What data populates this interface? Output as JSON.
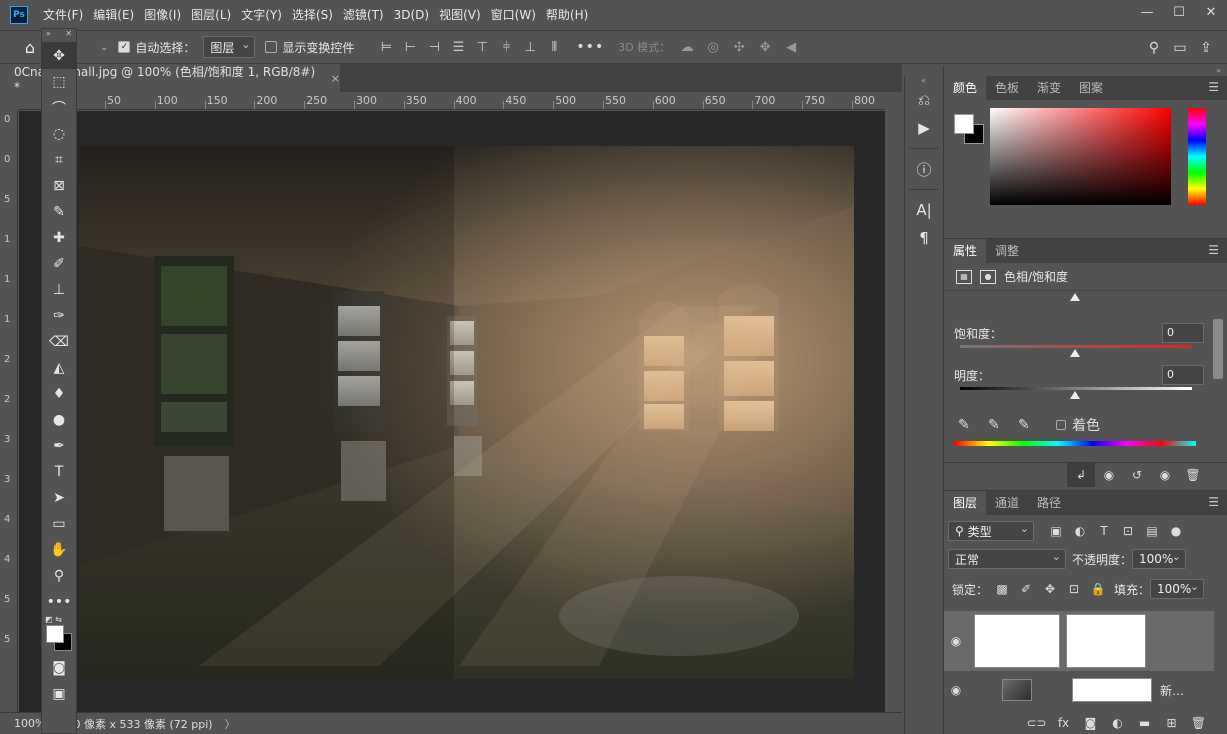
{
  "app": {
    "logo": "Ps",
    "menu": [
      "文件(F)",
      "编辑(E)",
      "图像(I)",
      "图层(L)",
      "文字(Y)",
      "选择(S)",
      "滤镜(T)",
      "3D(D)",
      "视图(V)",
      "窗口(W)",
      "帮助(H)"
    ],
    "window_controls": [
      "minimize-icon",
      "maximize-icon",
      "close-icon"
    ]
  },
  "options": {
    "auto_select_label": "自动选择：",
    "auto_select_checked": true,
    "target_value": "图层",
    "show_transform_label": "显示变换控件",
    "show_transform_checked": false,
    "more": "•••",
    "mode_3d_label": "3D 模式："
  },
  "document": {
    "tab_title": "0Cna…_small.jpg @ 100% (色相/饱和度 1, RGB/8#) *",
    "tab_close": "×"
  },
  "ruler": {
    "top_ticks": [
      "50",
      "100",
      "150",
      "200",
      "250",
      "300",
      "350",
      "400",
      "450",
      "500",
      "550",
      "600",
      "650",
      "700",
      "750",
      "800"
    ],
    "left_ticks": [
      "0",
      "0",
      "5",
      "1",
      "1",
      "1",
      "2",
      "2",
      "3",
      "3",
      "4",
      "4",
      "5",
      "5"
    ]
  },
  "status": {
    "zoom": "100%",
    "info": "0 像素 x 533 像素 (72 ppi)",
    "arrow": "〉"
  },
  "tools": [
    {
      "name": "move-tool-icon",
      "glyph": "✥",
      "selected": true
    },
    {
      "name": "marquee-tool-icon",
      "glyph": "⬚"
    },
    {
      "name": "lasso-tool-icon",
      "glyph": "⌒"
    },
    {
      "name": "quick-select-tool-icon",
      "glyph": "◌"
    },
    {
      "name": "crop-tool-icon",
      "glyph": "⌗"
    },
    {
      "name": "frame-tool-icon",
      "glyph": "⊠"
    },
    {
      "name": "eyedropper-tool-icon",
      "glyph": "✎"
    },
    {
      "name": "healing-tool-icon",
      "glyph": "✚"
    },
    {
      "name": "brush-tool-icon",
      "glyph": "✐"
    },
    {
      "name": "stamp-tool-icon",
      "glyph": "⊥"
    },
    {
      "name": "history-brush-tool-icon",
      "glyph": "✑"
    },
    {
      "name": "eraser-tool-icon",
      "glyph": "⌫"
    },
    {
      "name": "gradient-tool-icon",
      "glyph": "◭"
    },
    {
      "name": "blur-tool-icon",
      "glyph": "♦"
    },
    {
      "name": "dodge-tool-icon",
      "glyph": "●"
    },
    {
      "name": "pen-tool-icon",
      "glyph": "✒"
    },
    {
      "name": "type-tool-icon",
      "glyph": "T"
    },
    {
      "name": "path-select-tool-icon",
      "glyph": "➤"
    },
    {
      "name": "rectangle-tool-icon",
      "glyph": "▭"
    },
    {
      "name": "hand-tool-icon",
      "glyph": "✋"
    },
    {
      "name": "zoom-tool-icon",
      "glyph": "⚲"
    },
    {
      "name": "more-tools-icon",
      "glyph": "•••"
    }
  ],
  "panel_icons": [
    "history-icon",
    "actions-play-icon",
    "info-icon",
    "character-icon",
    "paragraph-icon"
  ],
  "color_panel": {
    "tabs": [
      "颜色",
      "色板",
      "渐变",
      "图案"
    ],
    "active": 0,
    "fg_color": "#ffffff",
    "bg_color": "#000000"
  },
  "properties_panel": {
    "tabs": [
      "属性",
      "调整"
    ],
    "active": 0,
    "title": "色相/饱和度",
    "saturation_label": "饱和度：",
    "saturation_value": "0",
    "lightness_label": "明度：",
    "lightness_value": "0",
    "colorize_label": "着色"
  },
  "layers_panel": {
    "tabs": [
      "图层",
      "通道",
      "路径"
    ],
    "active": 0,
    "filter_type": "类型",
    "blend_mode": "正常",
    "opacity_label": "不透明度：",
    "opacity_value": "100%",
    "lock_label": "锁定：",
    "fill_label": "填充：",
    "fill_value": "100%",
    "layer2_label": "新…"
  }
}
